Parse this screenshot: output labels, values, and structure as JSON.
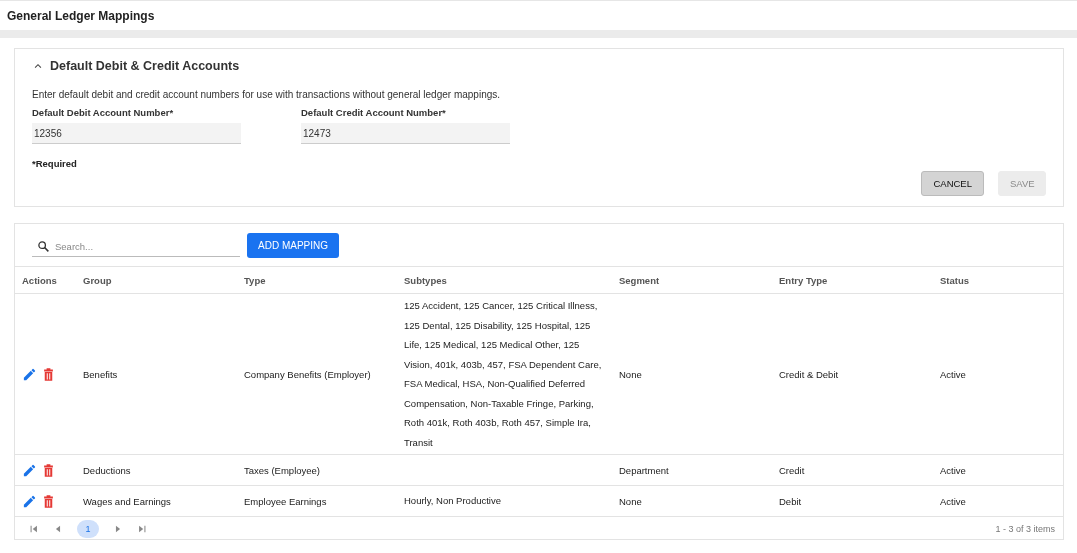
{
  "page_title": "General Ledger Mappings",
  "defaults_panel": {
    "title": "Default Debit & Credit Accounts",
    "expanded": true,
    "description": "Enter default debit and credit account numbers for use with transactions without general ledger mappings.",
    "fields": [
      {
        "label": "Default Debit Account Number*",
        "value": "12356"
      },
      {
        "label": "Default Credit Account Number*",
        "value": "12473"
      }
    ],
    "required_note": "*Required",
    "buttons": [
      {
        "label": "CANCEL",
        "disabled": false
      },
      {
        "label": "SAVE",
        "disabled": true
      }
    ]
  },
  "toolbar": {
    "search": {
      "placeholder": "Search..."
    },
    "add_button": "ADD MAPPING"
  },
  "table": {
    "columns": [
      "Actions",
      "Group",
      "Type",
      "Subtypes",
      "Segment",
      "Entry Type",
      "Status"
    ],
    "rows": [
      {
        "group": "Benefits",
        "type": "Company Benefits (Employer)",
        "subtypes": "125 Accident, 125 Cancer, 125 Critical Illness, 125 Dental, 125 Disability, 125 Hospital, 125 Life, 125 Medical, 125 Medical Other, 125 Vision, 401k, 403b, 457, FSA Dependent Care, FSA Medical, HSA, Non-Qualified Deferred Compensation, Non-Taxable Fringe, Parking, Roth 401k, Roth 403b, Roth 457, Simple Ira, Transit",
        "segment": "None",
        "entry_type": "Credit & Debit",
        "status": "Active"
      },
      {
        "group": "Deductions",
        "type": "Taxes (Employee)",
        "segment": "Department",
        "entry_type": "Credit",
        "status": "Active"
      },
      {
        "group": "Wages and Earnings",
        "type": "Employee Earnings",
        "subtypes": "Hourly, Non Productive",
        "segment": "None",
        "entry_type": "Debit",
        "status": "Active"
      }
    ]
  },
  "pager": {
    "pages": [
      {
        "label": "1",
        "selected": true
      }
    ],
    "summary": "1 - 3 of 3 items"
  }
}
